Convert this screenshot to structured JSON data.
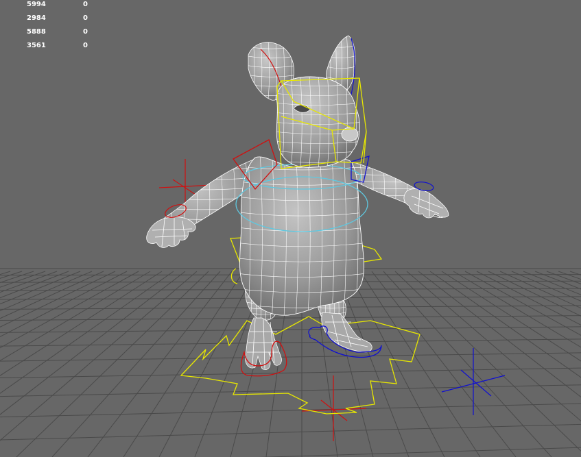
{
  "viewport": {
    "name": "3D Perspective Viewport",
    "background": "#676767",
    "grid_color": "#4a4a4a",
    "mesh_fill": "#9c9c9c",
    "wire_color": "#ffffff"
  },
  "hud": {
    "rows": [
      {
        "value": "5994",
        "selected": "0"
      },
      {
        "value": "2984",
        "selected": "0"
      },
      {
        "value": "5888",
        "selected": "0"
      },
      {
        "value": "3561",
        "selected": "0"
      }
    ]
  },
  "rig_controls": {
    "colors": {
      "left": "#d01010",
      "right": "#1010d0",
      "center": "#e8e800",
      "spine": "#5fc8e0"
    },
    "items": [
      {
        "name": "head-control",
        "color_role": "center"
      },
      {
        "name": "left-shoulder-control",
        "color_role": "left"
      },
      {
        "name": "right-shoulder-control",
        "color_role": "right"
      },
      {
        "name": "spine-ring-upper",
        "color_role": "spine"
      },
      {
        "name": "spine-ring-lower",
        "color_role": "spine"
      },
      {
        "name": "hip-control",
        "color_role": "center"
      },
      {
        "name": "root-control",
        "color_role": "center"
      },
      {
        "name": "left-foot-control",
        "color_role": "left"
      },
      {
        "name": "right-foot-control",
        "color_role": "right"
      },
      {
        "name": "left-arm-locator",
        "color_role": "left"
      },
      {
        "name": "left-leg-locator",
        "color_role": "left"
      },
      {
        "name": "right-leg-locator",
        "color_role": "right"
      }
    ]
  }
}
